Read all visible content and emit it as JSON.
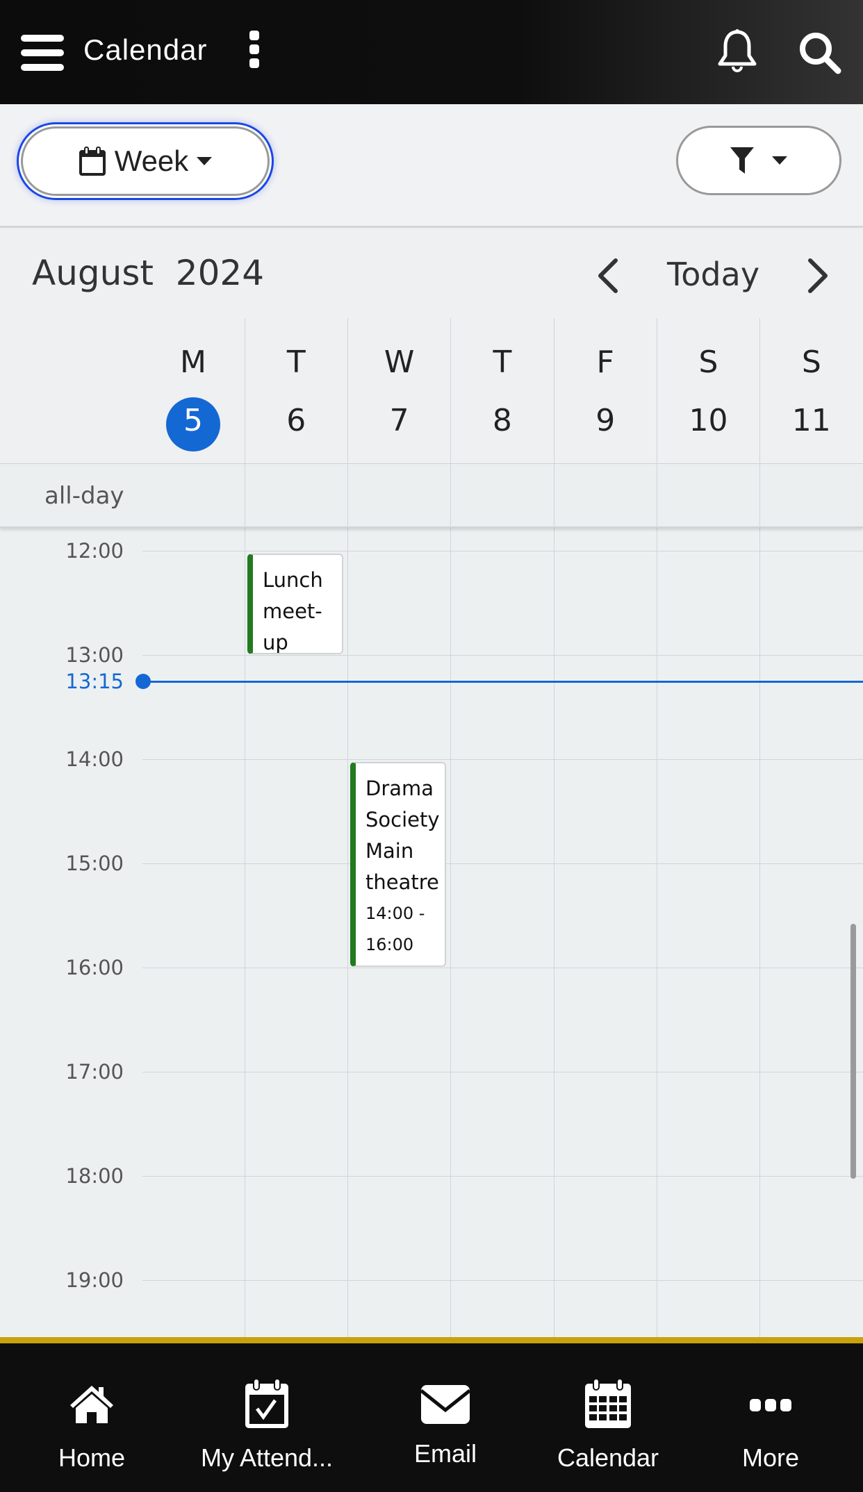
{
  "header": {
    "title": "Calendar",
    "icons": [
      "menu-icon",
      "more-vertical-icon",
      "bell-icon",
      "search-icon"
    ]
  },
  "toolbar": {
    "view_label": "Week",
    "view_icon": "calendar-icon",
    "filter_icon": "filter-icon"
  },
  "nav_row": {
    "month": "August  2024",
    "today_label": "Today"
  },
  "days": [
    {
      "letter": "M",
      "date": "5",
      "today": true
    },
    {
      "letter": "T",
      "date": "6"
    },
    {
      "letter": "W",
      "date": "7"
    },
    {
      "letter": "T",
      "date": "8"
    },
    {
      "letter": "F",
      "date": "9"
    },
    {
      "letter": "S",
      "date": "10"
    },
    {
      "letter": "S",
      "date": "11"
    }
  ],
  "allday_label": "all-day",
  "hours": [
    "12:00",
    "13:00",
    "14:00",
    "15:00",
    "16:00",
    "17:00",
    "18:00",
    "19:00"
  ],
  "now": {
    "label": "13:15"
  },
  "events": [
    {
      "title": "Lunch meet-up",
      "time": "",
      "day": 1,
      "start": "12:00",
      "end": "13:00"
    },
    {
      "title": "Drama Society Main theatre",
      "time": "14:00 - 16:00",
      "day": 2,
      "start": "14:00",
      "end": "16:00"
    }
  ],
  "colors": {
    "accent": "#1468d4",
    "event_bar": "#237a1f",
    "gold": "#c9a10b",
    "header_bg": "#0e0e0e"
  },
  "bottom_nav": [
    {
      "label": "Home",
      "icon": "home-icon"
    },
    {
      "label": "My Attend...",
      "icon": "calendar-check-icon"
    },
    {
      "label": "Email",
      "icon": "envelope-icon"
    },
    {
      "label": "Calendar",
      "icon": "calendar-grid-icon"
    },
    {
      "label": "More",
      "icon": "more-horizontal-icon"
    }
  ]
}
